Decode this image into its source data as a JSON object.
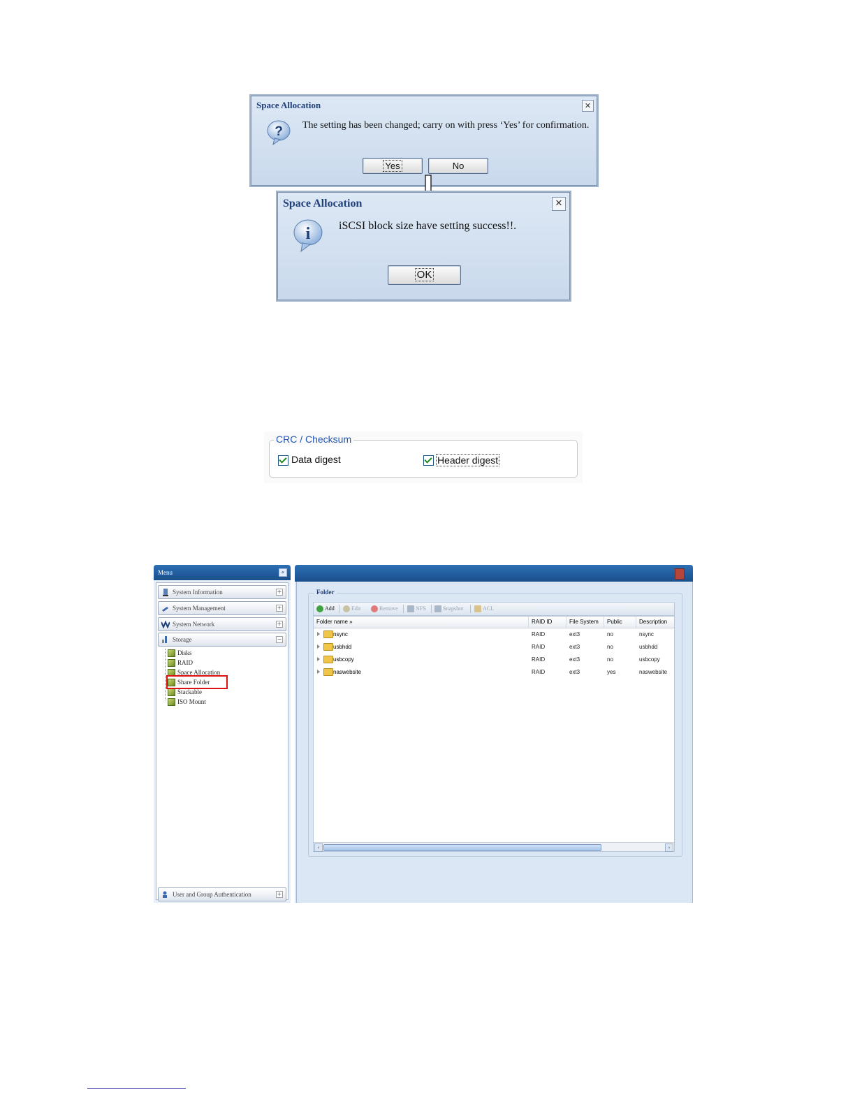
{
  "dialog_confirm": {
    "title": "Space Allocation",
    "message": "The setting has been changed; carry on with press ‘Yes’ for confirmation.",
    "yes_label": "Yes",
    "no_label": "No",
    "close_glyph": "✕",
    "icon": "question-icon"
  },
  "dialog_success": {
    "title": "Space Allocation",
    "message": "iSCSI block size have setting success!!.",
    "ok_label": "OK",
    "close_glyph": "✕",
    "icon": "info-icon"
  },
  "crc": {
    "legend": "CRC / Checksum",
    "data_digest": {
      "label": "Data digest",
      "checked": true
    },
    "header_digest": {
      "label": "Header digest",
      "checked": true
    }
  },
  "app": {
    "menu": {
      "title": "Menu",
      "collapse_glyph": "«",
      "sections": [
        {
          "label": "System Information",
          "toggle": "+",
          "icon": "info-icon"
        },
        {
          "label": "System Management",
          "toggle": "+",
          "icon": "wrench-icon"
        },
        {
          "label": "System Network",
          "toggle": "+",
          "icon": "network-icon"
        },
        {
          "label": "Storage",
          "toggle": "−",
          "icon": "storage-icon"
        }
      ],
      "storage_items": [
        "Disks",
        "RAID",
        "Space Allocation",
        "Share Folder",
        "Stackable",
        "ISO Mount"
      ],
      "highlighted_item": "Share Folder",
      "bottom_section": {
        "label": "User and Group Authentication",
        "toggle": "+",
        "icon": "users-icon"
      }
    },
    "folder": {
      "legend": "Folder",
      "toolbar": [
        {
          "label": "Add",
          "enabled": true,
          "icon": "add-icon"
        },
        {
          "label": "Edit",
          "enabled": false,
          "icon": "edit-icon"
        },
        {
          "label": "Remove",
          "enabled": false,
          "icon": "remove-icon"
        },
        {
          "label": "NFS",
          "enabled": false,
          "icon": "nfs-icon"
        },
        {
          "label": "Snapshot",
          "enabled": false,
          "icon": "snapshot-icon"
        },
        {
          "label": "ACL",
          "enabled": false,
          "icon": "acl-icon"
        }
      ],
      "columns": [
        "Folder name »",
        "RAID ID",
        "File System",
        "Public",
        "Description"
      ],
      "rows": [
        {
          "name": "nsync",
          "raid": "RAID",
          "fs": "ext3",
          "public": "no",
          "description": "nsync"
        },
        {
          "name": "usbhdd",
          "raid": "RAID",
          "fs": "ext3",
          "public": "no",
          "description": "usbhdd"
        },
        {
          "name": "usbcopy",
          "raid": "RAID",
          "fs": "ext3",
          "public": "no",
          "description": "usbcopy"
        },
        {
          "name": "naswebsite",
          "raid": "RAID",
          "fs": "ext3",
          "public": "yes",
          "description": "naswebsite"
        }
      ],
      "scroll_left_glyph": "‹",
      "scroll_right_glyph": "›"
    }
  }
}
